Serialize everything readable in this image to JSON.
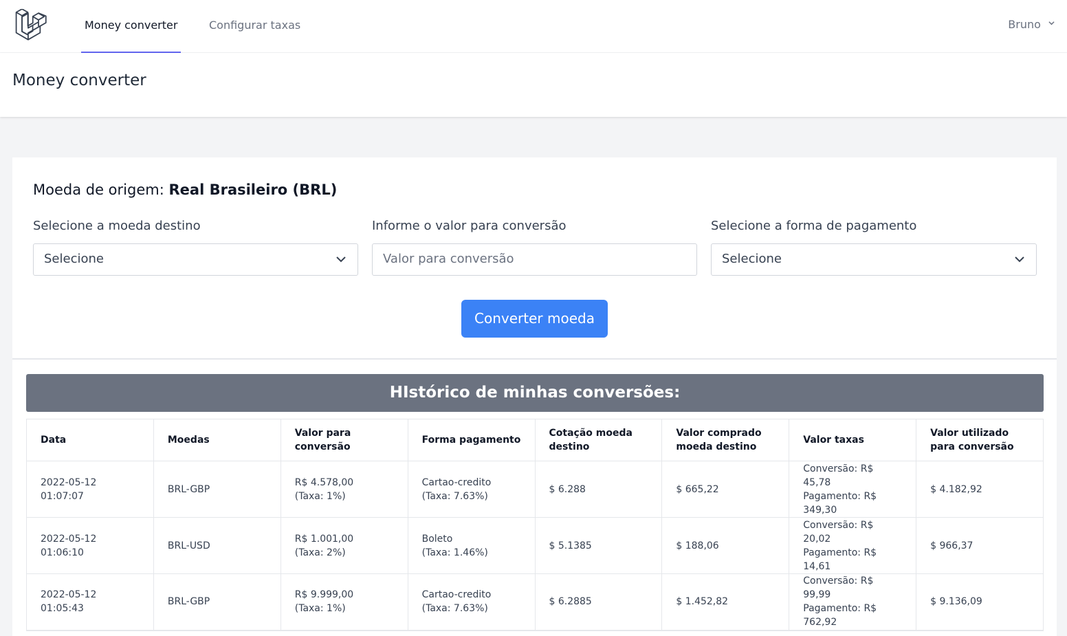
{
  "nav": {
    "links": [
      {
        "label": "Money converter",
        "active": true
      },
      {
        "label": "Configurar taxas",
        "active": false
      }
    ],
    "user": "Bruno"
  },
  "header": {
    "title": "Money converter"
  },
  "form": {
    "origin_label": "Moeda de origem:",
    "origin_value": "Real Brasileiro (BRL)",
    "target_currency": {
      "label": "Selecione a moeda destino",
      "value": "Selecione"
    },
    "amount": {
      "label": "Informe o valor para conversão",
      "placeholder": "Valor para conversão"
    },
    "payment": {
      "label": "Selecione a forma de pagamento",
      "value": "Selecione"
    },
    "submit_label": "Converter moeda"
  },
  "history": {
    "title": "HIstórico de minhas conversões:",
    "columns": [
      "Data",
      "Moedas",
      "Valor para conversão",
      "Forma pagamento",
      "Cotação moeda destino",
      "Valor comprado moeda destino",
      "Valor taxas",
      "Valor utilizado para conversão"
    ],
    "rows": [
      {
        "date": "2022-05-12",
        "time": "01:07:07",
        "pair": "BRL-GBP",
        "amount": "R$ 4.578,00",
        "amount_fee": "(Taxa: 1%)",
        "payment": "Cartao-credito",
        "payment_fee": "(Taxa: 7.63%)",
        "rate": "$ 6.288",
        "bought": "$ 665,22",
        "fees_conv": "Conversão: R$ 45,78",
        "fees_pay": "Pagamento: R$ 349,30",
        "used": "$ 4.182,92"
      },
      {
        "date": "2022-05-12",
        "time": "01:06:10",
        "pair": "BRL-USD",
        "amount": "R$ 1.001,00",
        "amount_fee": "(Taxa: 2%)",
        "payment": "Boleto",
        "payment_fee": "(Taxa: 1.46%)",
        "rate": "$ 5.1385",
        "bought": "$ 188,06",
        "fees_conv": "Conversão: R$ 20,02",
        "fees_pay": "Pagamento: R$ 14,61",
        "used": "$ 966,37"
      },
      {
        "date": "2022-05-12",
        "time": "01:05:43",
        "pair": "BRL-GBP",
        "amount": "R$ 9.999,00",
        "amount_fee": "(Taxa: 1%)",
        "payment": "Cartao-credito",
        "payment_fee": "(Taxa: 7.63%)",
        "rate": "$ 6.2885",
        "bought": "$ 1.452,82",
        "fees_conv": "Conversão: R$ 99,99",
        "fees_pay": "Pagamento: R$ 762,92",
        "used": "$ 9.136,09"
      }
    ]
  },
  "colors": {
    "accent": "#3b82f6",
    "nav_indicator": "#6366f1",
    "banner": "#6b7280"
  },
  "icons": [
    "laravel-logo-icon",
    "chevron-down-icon"
  ]
}
